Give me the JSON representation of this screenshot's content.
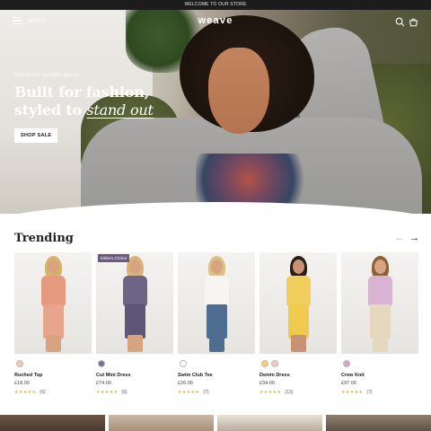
{
  "announcement": "WELCOME TO OUR STORE",
  "header": {
    "menu_label": "MENU",
    "logo": "weave",
    "icons": [
      "search-icon",
      "cart-icon"
    ]
  },
  "hero": {
    "eyebrow": "Effortlessly versatile pieces",
    "headline_line1": "Built for fashion,",
    "headline_line2_plain": "styled to",
    "headline_line2_accent": "stand out",
    "cta": "SHOP SALE"
  },
  "trending": {
    "title": "Trending",
    "prev_icon": "arrow-left-icon",
    "next_icon": "arrow-right-icon",
    "products": [
      {
        "name": "Ruched Top",
        "price": "£18.00",
        "count": "(6)",
        "badge": "",
        "rating_stars": 5,
        "swatches": [
          "#f2c9b5"
        ]
      },
      {
        "name": "Cut Mini Dress",
        "price": "£74.00",
        "count": "(6)",
        "badge": "Editors Choice",
        "rating_stars": 5,
        "swatches": [
          "#7a6f93"
        ]
      },
      {
        "name": "Swim Club Tee",
        "price": "£26.00",
        "count": "(7)",
        "badge": "",
        "rating_stars": 5,
        "swatches": [
          "#ffffff"
        ]
      },
      {
        "name": "Denim Dress",
        "price": "£34.00",
        "count": "(13)",
        "badge": "",
        "rating_stars": 5,
        "swatches": [
          "#f2d06b",
          "#f3c6c8"
        ]
      },
      {
        "name": "Crew Knit",
        "price": "£97.00",
        "count": "(7)",
        "badge": "",
        "rating_stars": 5,
        "swatches": [
          "#c9a9c7"
        ]
      }
    ]
  },
  "colors": {
    "announcement_bg": "#1c1c1c",
    "star": "#e3b34a",
    "badge_bg": "#6a5a80"
  }
}
